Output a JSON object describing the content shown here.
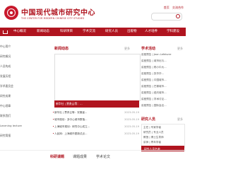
{
  "header": {
    "brand_cn": "中国现代城市研究中心",
    "brand_en": "THE CENTER FOR MODERN CHINESE CITY STUDIES",
    "links": [
      "首页",
      "交流合作"
    ],
    "search_placeholder": ""
  },
  "nav": {
    "items": [
      {
        "label": "中心概况"
      },
      {
        "label": "新闻动态"
      },
      {
        "label": "科研项目"
      },
      {
        "label": "学术交流"
      },
      {
        "label": "研究人员"
      },
      {
        "label": "出版物"
      },
      {
        "label": "人才培养"
      },
      {
        "label": "学科建设"
      },
      {
        "label": "资料"
      }
    ]
  },
  "left_list": {
    "items": [
      "中心简介",
      "研究概况",
      "人员构成",
      "发展历程",
      "学术委员会",
      "研究成果",
      "中心规章",
      "联系我们",
      "Learning lecture",
      "研究简报"
    ]
  },
  "center": {
    "title": "新闻动态",
    "more": "更多",
    "image_caption": "新华社 | 贾贵云等：...",
    "news": [
      {
        "title": "新华社 | 贾贵云等：安徽省...",
        "date": "2023-05-19"
      },
      {
        "title": "城市规划：多中心城市群落...",
        "date": "2023-05-19"
      },
      {
        "title": "上海城市规划：研究中心成立...",
        "date": "2023-05-19"
      },
      {
        "title": "人民网：上海城市更新试点...",
        "date": "2023-05-19"
      }
    ]
  },
  "right": {
    "title": "学术活动",
    "more": "更多",
    "items": [
      "讲座预告 | Jean Lefebvre",
      "讲座预告 | 城市化与...",
      "讲座预告 | 杨小中大...",
      "讲座预告 | 张华华...",
      "讲座预告 | 中国城市...",
      "讲座预告 | 巴黎城市...",
      "讲座预告 | 纽约城市...",
      "讲座预告 | 学术讨论...",
      "讲座预告 | 国际会议..."
    ],
    "people_title": "研究人员",
    "people_more": "更多",
    "people_items": [
      "主任 | 专家学者",
      "研究员 | 专业人员",
      "教授 | 博士生导师",
      "讲师 | 青年学者"
    ],
    "people_button": "研究人员名单"
  },
  "tabs": [
    {
      "label": "科研课题"
    },
    {
      "label": "课题成果"
    },
    {
      "label": "学术论文"
    }
  ]
}
